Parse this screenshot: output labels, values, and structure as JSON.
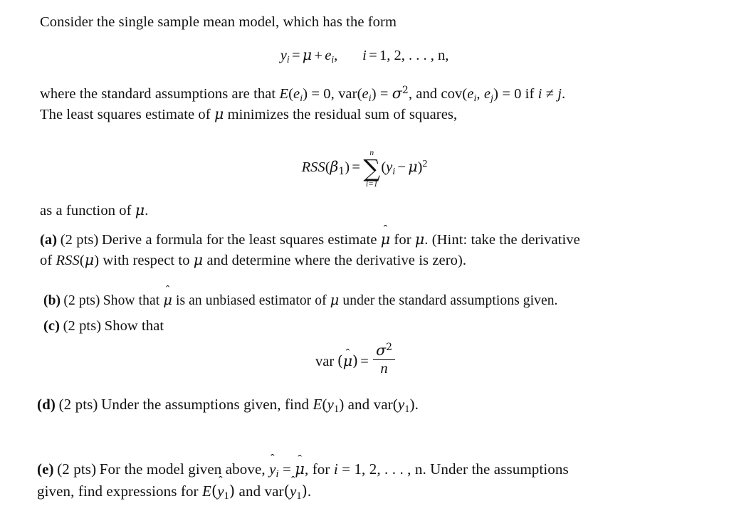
{
  "document": {
    "type": "statistics-homework-problem",
    "intro": {
      "line1": "Consider the single sample mean model, which has the form"
    },
    "equation_model": {
      "lhs_var": "y",
      "lhs_sub": "i",
      "eq": "=",
      "mu": "μ",
      "plus": "+",
      "err_var": "e",
      "err_sub": "i",
      "comma": ",",
      "index_var": "i",
      "index_eq": "=",
      "index_values": "1, 2, . . . , n,",
      "plain": "y_i = μ + e_i,    i = 1, 2, …, n,"
    },
    "assumptions": {
      "seg1": "where the standard assumptions are that ",
      "E": "E",
      "e": "e",
      "sub_i": "i",
      "eq0a": " = 0, ",
      "var": "var",
      "eq_sigma": " = ",
      "sigma": "σ",
      "sup2": "2",
      "and_cov": ", and ",
      "cov": "cov",
      "sub_j": "j",
      "eq0b": " = 0 if ",
      "neq": " ≠ ",
      "period": ".",
      "line2": "The least squares estimate of μ minimizes the residual sum of squares,",
      "plain_line1": "where the standard assumptions are that E(e_i) = 0, var(e_i) = σ², and cov(e_i, e_j) = 0 if i ≠ j."
    },
    "equation_rss": {
      "rss": "RSS",
      "beta": "β",
      "beta_sub": "1",
      "eq": "=",
      "sum_upper": "n",
      "sum_lower": "i=1",
      "sum_symbol": "∑",
      "y": "y",
      "y_sub": "i",
      "minus": "−",
      "mu": "μ",
      "power": "2",
      "plain": "RSS(β₁) = Σ_{i=1}^{n} (y_i − μ)²"
    },
    "after_rss": "as a function of μ.",
    "parts": [
      {
        "label": "(a)",
        "points": "(2 pts)",
        "line1_pre": "Derive a formula for the least squares estimate ",
        "muhat": "μ̂",
        "line1_mid": " for ",
        "mu": "μ",
        "line1_post": ". (Hint: take the derivative",
        "line2_pre": "of ",
        "rss": "RSS",
        "line2_post": " with respect to μ and determine where the derivative is zero).",
        "plain": "(a) (2 pts) Derive a formula for the least squares estimate μ̂ for μ. (Hint: take the derivative of RSS(μ) with respect to μ and determine where the derivative is zero)."
      },
      {
        "label": "(b)",
        "points": "(2 pts)",
        "text_pre": "Show that ",
        "muhat": "μ̂",
        "text_mid": " is an unbiased estimator of ",
        "mu": "μ",
        "text_post": " under the standard assumptions given.",
        "plain": "(b) (2 pts) Show that μ̂ is an unbiased estimator of μ under the standard assumptions given."
      },
      {
        "label": "(c)",
        "points": "(2 pts)",
        "text": "Show that",
        "plain": "(c) (2 pts) Show that"
      },
      {
        "label": "(d)",
        "points": "(2 pts)",
        "text_pre": "Under the assumptions given, find ",
        "E": "E",
        "y": "y",
        "y_sub": "1",
        "text_mid": " and ",
        "var": "var",
        "text_post": ".",
        "plain": "(d) (2 pts) Under the assumptions given, find E(y₁) and var(y₁)."
      },
      {
        "label": "(e)",
        "points": "(2 pts)",
        "line1_pre": "For the model given above, ",
        "yhat": "ŷ",
        "yhat_sub": "i",
        "eq": " = ",
        "muhat": "μ̂",
        "line1_mid": ", for ",
        "i": "i",
        "index_values": " = 1, 2, . . . , n",
        "line1_post": ". Under the assumptions",
        "line2_pre": "given, find expressions for ",
        "E": "E",
        "yhat1_sub": "1",
        "line2_mid": " and ",
        "var": "var",
        "line2_post": ".",
        "plain": "(e) (2 pts) For the model given above, ŷ_i = μ̂, for i = 1, 2, …, n. Under the assumptions given, find expressions for E(ŷ₁) and var(ŷ₁)."
      }
    ],
    "equation_var": {
      "var": "var",
      "muhat": "μ̂",
      "eq": "=",
      "sigma": "σ",
      "power": "2",
      "n": "n",
      "plain": "var (μ̂) = σ² / n"
    }
  }
}
